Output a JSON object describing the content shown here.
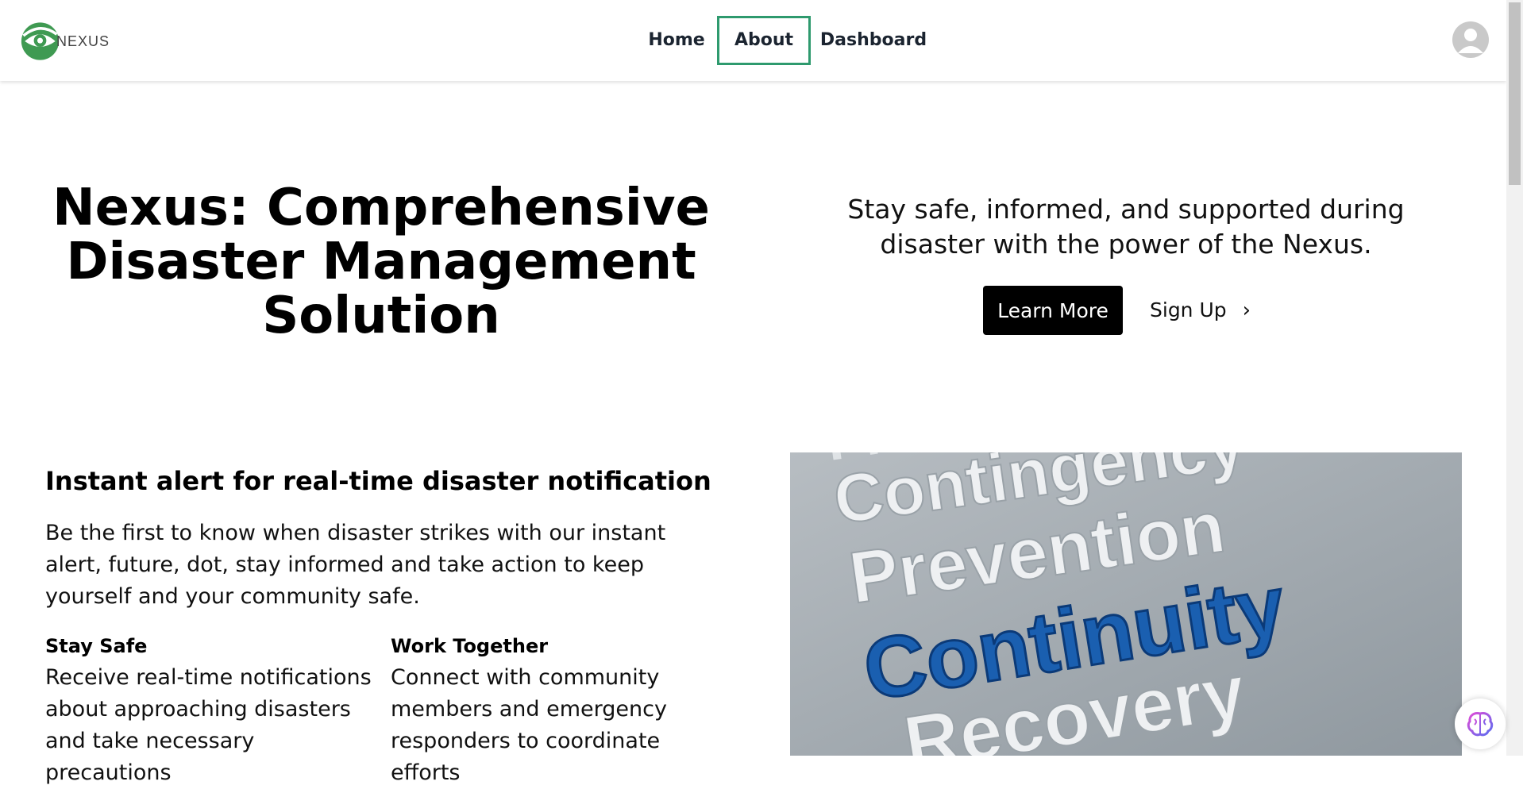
{
  "brand": {
    "logo_text": "NEXUS"
  },
  "nav": {
    "items": [
      {
        "label": "Home",
        "active": false
      },
      {
        "label": "About",
        "active": true
      },
      {
        "label": "Dashboard",
        "active": false
      }
    ],
    "active_color": "#2e9a6e"
  },
  "user_menu": {
    "icon": "user-avatar-icon"
  },
  "hero": {
    "title": "Nexus: Comprehensive Disaster Management Solution",
    "tagline": "Stay safe, informed, and supported during disaster with the power of the Nexus.",
    "learn_more_label": "Learn More",
    "sign_up_label": "Sign Up",
    "sign_up_icon": "chevron-right-icon"
  },
  "feature": {
    "heading": "Instant alert for real-time disaster notification",
    "description": "Be the first to know when disaster strikes with our instant alert, future, dot, stay informed and take action to keep yourself and your community safe.",
    "columns": [
      {
        "title": "Stay Safe",
        "text": "Receive real-time notifications about approaching disasters and take necessary precautions"
      },
      {
        "title": "Work Together",
        "text": "Connect with community members and emergency responders to coordinate efforts"
      }
    ],
    "image_words": [
      "Contingency",
      "Prevention",
      "Continuity",
      "Recovery"
    ]
  },
  "assistant": {
    "icon": "brain-icon"
  }
}
